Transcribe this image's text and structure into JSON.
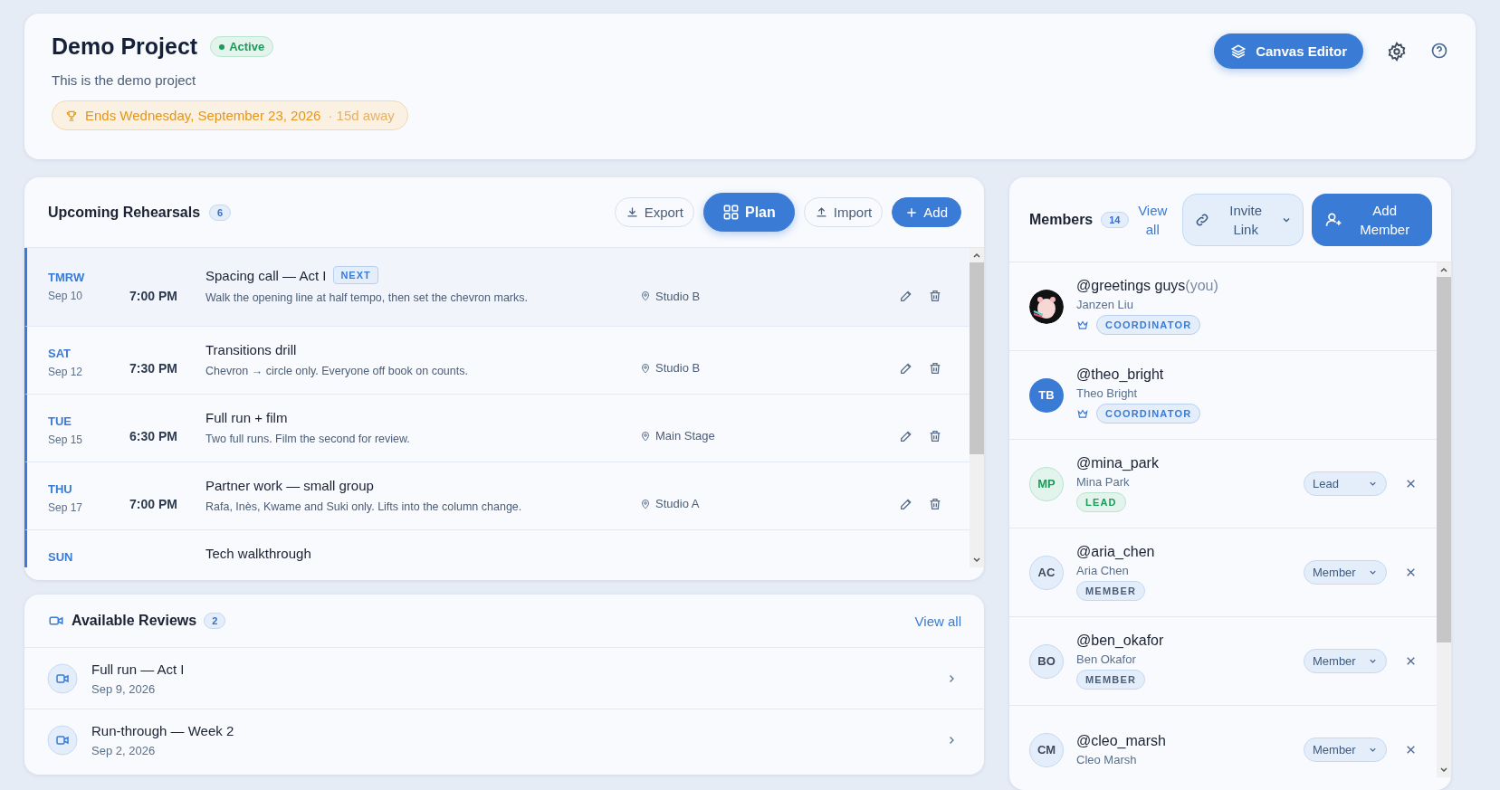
{
  "project": {
    "title": "Demo Project",
    "status": "Active",
    "description": "This is the demo project",
    "deadline": "Ends Wednesday, September 23, 2026",
    "deadline_note": "· 15d away",
    "primary_button": "Canvas Editor"
  },
  "rehearsals": {
    "title": "Upcoming Rehearsals",
    "count": "6",
    "actions": [
      {
        "label": "Export",
        "kind": "export",
        "selected": false
      },
      {
        "label": "Plan",
        "kind": "plan",
        "selected": true
      },
      {
        "label": "Import",
        "kind": "import",
        "selected": false
      },
      {
        "label": "Add",
        "kind": "add",
        "selected": false
      }
    ],
    "rows": [
      {
        "day": "TMRW",
        "date": "Sep 10",
        "time": "7:00 PM",
        "title": "Spacing call — Act I",
        "badge": "NEXT",
        "note": "Walk the opening line at half tempo, then set the chevron marks.",
        "location": "Studio B",
        "selected": true
      },
      {
        "day": "SAT",
        "date": "Sep 12",
        "time": "7:30 PM",
        "title": "Transitions drill",
        "note": "Chevron → circle only. Everyone off book on counts.",
        "location": "Studio B",
        "selected": false
      },
      {
        "day": "TUE",
        "date": "Sep 15",
        "time": "6:30 PM",
        "title": "Full run + film",
        "note": "Two full runs. Film the second for review.",
        "location": "Main Stage",
        "selected": false
      },
      {
        "day": "THU",
        "date": "Sep 17",
        "time": "7:00 PM",
        "title": "Partner work — small group",
        "note": "Rafa, Inès, Kwame and Suki only. Lifts into the column change.",
        "location": "Studio A",
        "selected": false
      },
      {
        "day": "SUN",
        "title": "Tech walkthrough",
        "selected": false
      }
    ]
  },
  "reviews": {
    "title": "Available Reviews",
    "count": "2",
    "link": "View all",
    "items": [
      {
        "title": "Full run — Act I",
        "date": "Sep 9, 2026"
      },
      {
        "title": "Run-through — Week 2",
        "date": "Sep 2, 2026"
      }
    ]
  },
  "members": {
    "title": "Members",
    "count": "14",
    "link": "View all",
    "invite_button": "Invite Link",
    "add_button": "Add Member",
    "items": [
      {
        "handle": "@greetings guys",
        "suffix": "(you)",
        "name": "Janzen Liu",
        "role": {
          "kind": "coordinator",
          "label": "COORDINATOR"
        }
      },
      {
        "handle": "@theo_bright",
        "name": "Theo Bright",
        "avatar": {
          "kind": "solid",
          "initials": "TB"
        },
        "role": {
          "kind": "coordinator",
          "label": "COORDINATOR"
        }
      },
      {
        "handle": "@mina_park",
        "name": "Mina Park",
        "avatar": {
          "kind": "lead",
          "initials": "MP"
        },
        "role": {
          "kind": "lead",
          "label": "LEAD"
        },
        "select": "Lead"
      },
      {
        "handle": "@aria_chen",
        "name": "Aria Chen",
        "avatar": {
          "kind": "plain",
          "initials": "AC"
        },
        "role": {
          "kind": "member",
          "label": "MEMBER"
        },
        "select": "Member"
      },
      {
        "handle": "@ben_okafor",
        "name": "Ben Okafor",
        "avatar": {
          "kind": "plain",
          "initials": "BO"
        },
        "role": {
          "kind": "member",
          "label": "MEMBER"
        },
        "select": "Member"
      },
      {
        "handle": "@cleo_marsh",
        "name": "Cleo Marsh",
        "avatar": {
          "kind": "plain",
          "initials": "CM"
        },
        "select": "Member"
      }
    ]
  }
}
